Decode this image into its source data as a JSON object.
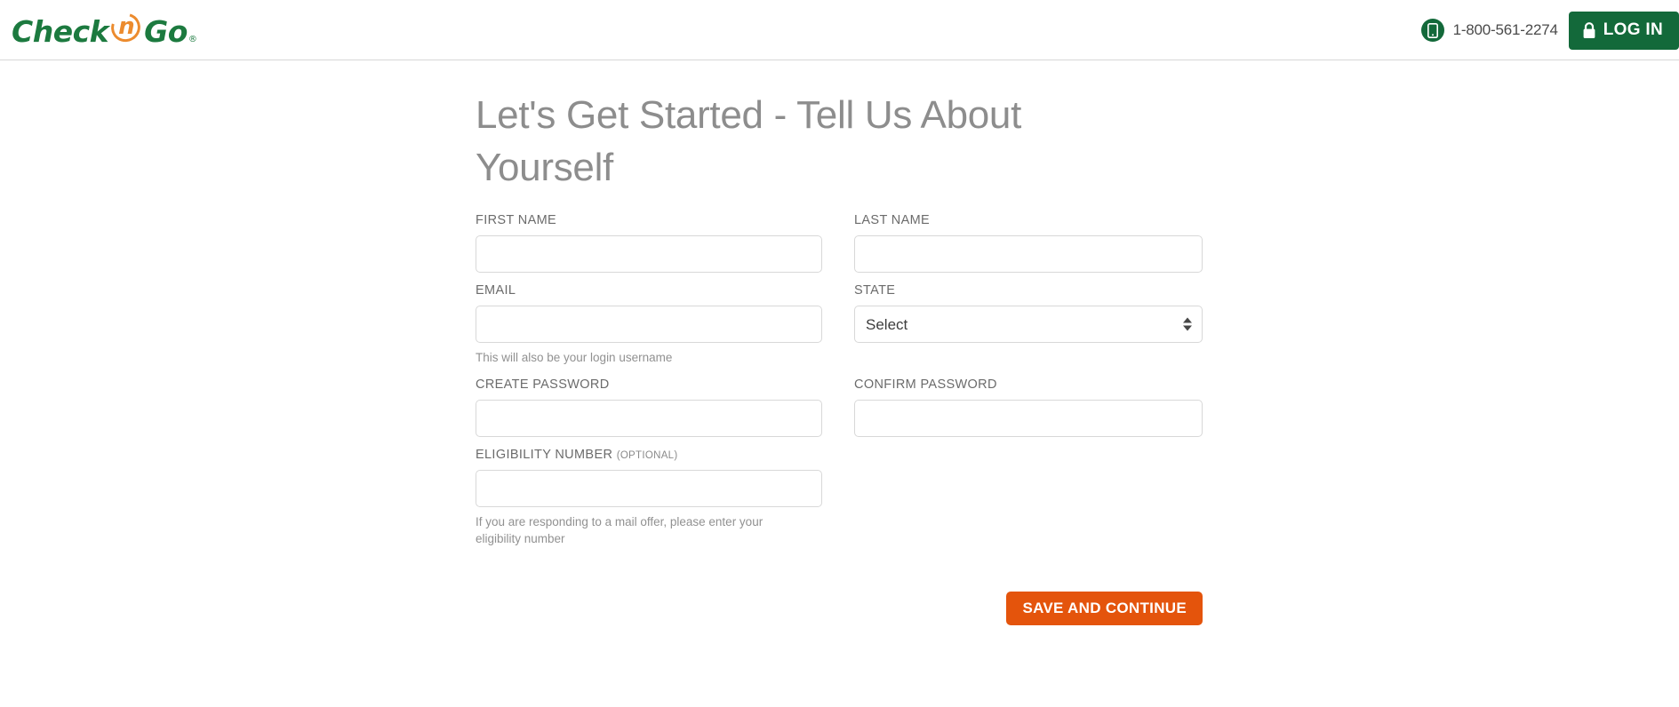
{
  "header": {
    "logo": {
      "part1": "Check",
      "circled_letter": "n",
      "part2": "Go",
      "registered_mark": "®",
      "green": "#1c7a3f",
      "orange": "#ec8b2e"
    },
    "phone_icon": "mobile-phone-icon",
    "phone_number": "1-800-561-2274",
    "login_label": "LOG IN",
    "login_icon": "lock-icon",
    "login_color": "#13693a"
  },
  "main": {
    "title": "Let's Get Started - Tell Us About Yourself",
    "fields": {
      "first_name": {
        "label": "FIRST NAME",
        "value": "",
        "placeholder": ""
      },
      "last_name": {
        "label": "LAST NAME",
        "value": "",
        "placeholder": ""
      },
      "email": {
        "label": "EMAIL",
        "value": "",
        "placeholder": "",
        "help": "This will also be your login username"
      },
      "state": {
        "label": "STATE",
        "selected": "Select",
        "options": [
          "Select"
        ]
      },
      "create_password": {
        "label": "CREATE PASSWORD",
        "value": "",
        "placeholder": ""
      },
      "confirm_password": {
        "label": "CONFIRM PASSWORD",
        "value": "",
        "placeholder": ""
      },
      "eligibility_number": {
        "label": "ELIGIBILITY NUMBER",
        "optional_tag": "(OPTIONAL)",
        "value": "",
        "placeholder": "",
        "help": "If you are responding to a mail offer, please enter your eligibility number"
      }
    },
    "submit_label": "SAVE AND CONTINUE",
    "submit_color": "#e4540c"
  }
}
